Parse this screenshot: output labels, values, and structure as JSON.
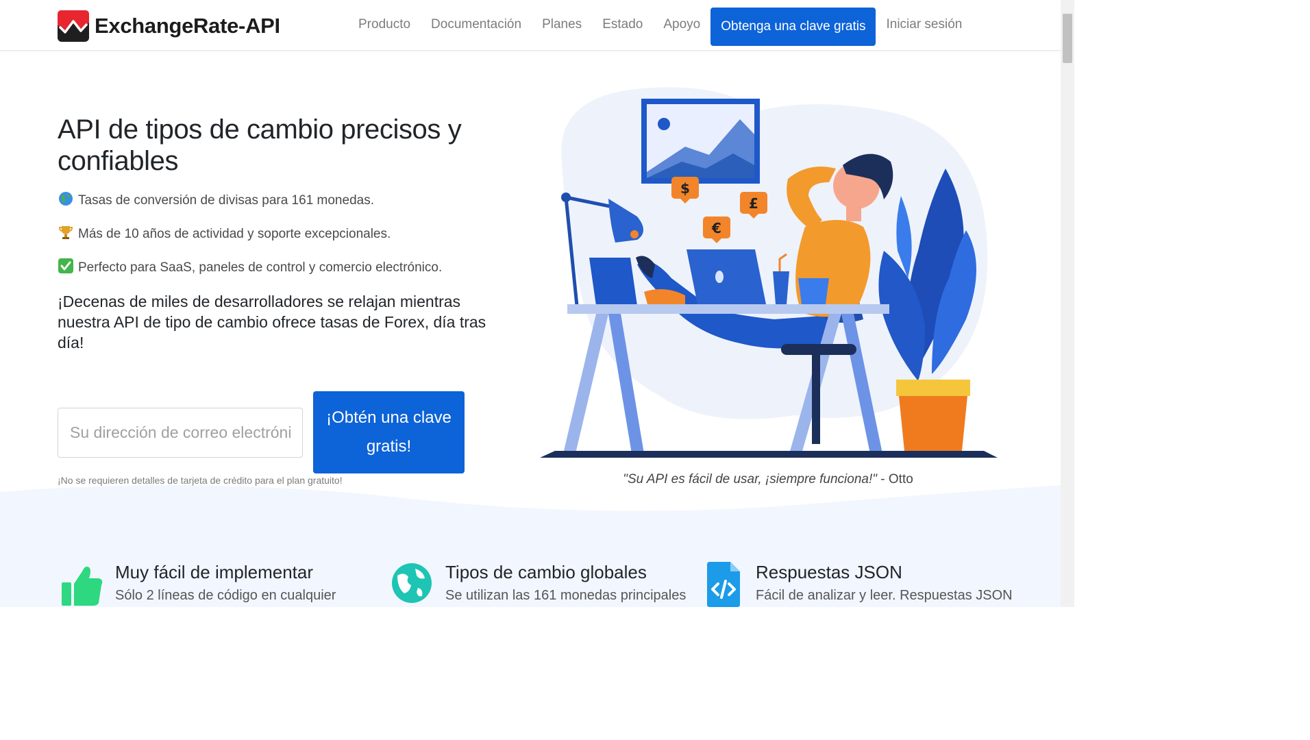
{
  "brand": {
    "name": "ExchangeRate-API"
  },
  "nav": {
    "links": [
      "Producto",
      "Documentación",
      "Planes",
      "Estado",
      "Apoyo"
    ],
    "cta": "Obtenga una clave gratis",
    "login": "Iniciar sesión"
  },
  "hero": {
    "title": "API de tipos de cambio precisos y confiables",
    "features": [
      {
        "icon": "globe-icon",
        "text": "Tasas de conversión de divisas para 161 monedas."
      },
      {
        "icon": "trophy-icon",
        "text": "Más de 10 años de actividad y soporte excepcionales."
      },
      {
        "icon": "check-icon",
        "text": "Perfecto para SaaS, paneles de control y comercio electrónico."
      }
    ],
    "lead": "¡Decenas de miles de desarrolladores se relajan mientras nuestra API de tipo de cambio ofrece tasas de Forex, día tras día!",
    "email_placeholder": "Su dirección de correo electrónico",
    "cta": "¡Obtén una clave gratis!",
    "fine_print": "¡No se requieren detalles de tarjeta de crédito para el plan gratuito!"
  },
  "quote": {
    "text": "\"Su API es fácil de usar, ¡siempre funciona!\"",
    "author": " - Otto"
  },
  "illustration": {
    "currencies": [
      "$",
      "£",
      "€"
    ]
  },
  "features": [
    {
      "icon": "thumbs-up-icon",
      "title": "Muy fácil de implementar",
      "desc": "Sólo 2 líneas de código en cualquier"
    },
    {
      "icon": "globe-icon",
      "title": "Tipos de cambio globales",
      "desc": "Se utilizan las 161 monedas principales"
    },
    {
      "icon": "code-file-icon",
      "title": "Respuestas JSON",
      "desc": "Fácil de analizar y leer. Respuestas JSON"
    }
  ],
  "colors": {
    "primary": "#0d63d8",
    "accent": "#1b6fe0",
    "orange": "#f39a2c",
    "teal": "#1ec4b4",
    "green": "#2dd881"
  }
}
